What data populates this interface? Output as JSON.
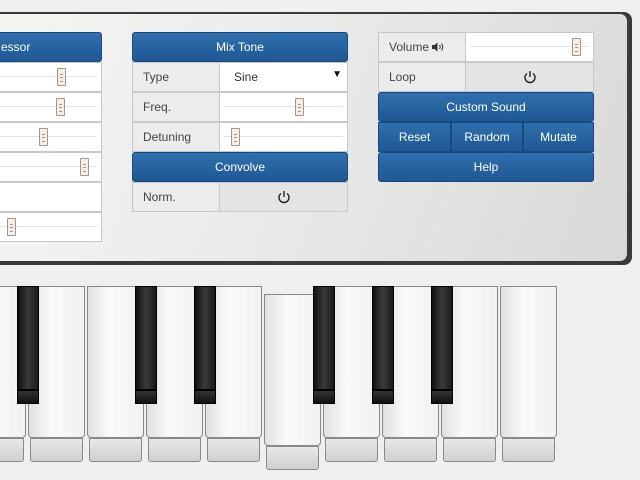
{
  "compressor_header": "essor",
  "mix_tone": {
    "header": "Mix Tone",
    "type_label": "Type",
    "type_value": "Sine",
    "freq_label": "Freq.",
    "freq_level": 0.62,
    "detuning_label": "Detuning",
    "detuning_level": 0.0
  },
  "convolve": {
    "header": "Convolve",
    "norm_label": "Norm."
  },
  "output": {
    "volume_label": "Volume",
    "volume_level": 0.95,
    "loop_label": "Loop"
  },
  "buttons": {
    "custom_sound": "Custom Sound",
    "reset": "Reset",
    "random": "Random",
    "mutate": "Mutate",
    "help": "Help"
  },
  "compressor_levels": [
    0.72,
    0.71,
    0.4,
    0.95,
    null,
    0.1
  ],
  "icons": {
    "power": "power-icon",
    "speaker": "speaker-icon",
    "dropdown": "dropdown-arrow-icon"
  },
  "colors": {
    "button_blue": "#2866a4",
    "panel_border": "#3a3a3a"
  }
}
